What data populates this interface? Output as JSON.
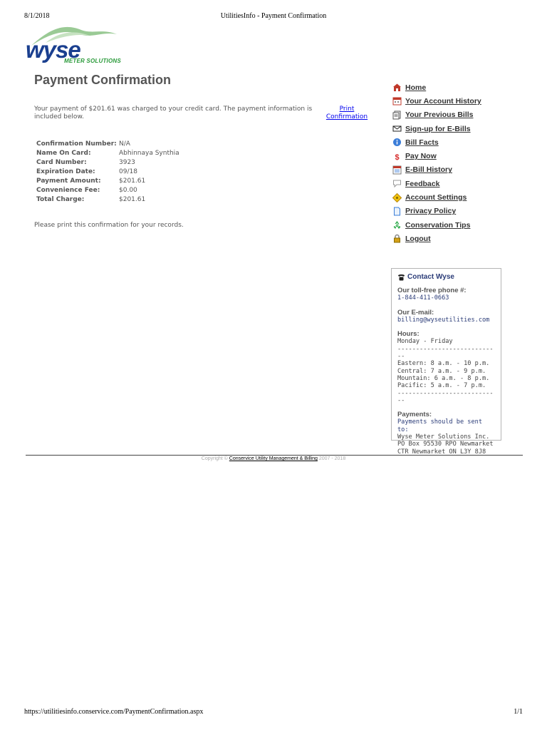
{
  "print_header": {
    "date": "8/1/2018",
    "title": "UtilitiesInfo - Payment Confirmation"
  },
  "print_footer": {
    "url": "https://utilitiesinfo.conservice.com/PaymentConfirmation.aspx",
    "page": "1/1"
  },
  "logo": {
    "word": "wyse",
    "sub": "METER SOLUTIONS",
    "colors": {
      "word": "#1a3f8f",
      "sub": "#2a9a3a",
      "swoosh": "#8fc48a"
    }
  },
  "page_title": "Payment Confirmation",
  "intro": "Your payment of $201.61 was charged to your credit card. The payment information is included below.",
  "print_link": "Print Confirmation",
  "confirmation": [
    {
      "label": "Confirmation Number:",
      "value": "N/A"
    },
    {
      "label": "Name On Card:",
      "value": "Abhinnaya Synthia"
    },
    {
      "label": "Card Number:",
      "value": "3923"
    },
    {
      "label": "Expiration Date:",
      "value": "09/18"
    },
    {
      "label": "Payment Amount:",
      "value": "$201.61"
    },
    {
      "label": "Convenience Fee:",
      "value": "$0.00"
    },
    {
      "label": "Total Charge:",
      "value": "$201.61"
    }
  ],
  "note": "Please print this confirmation for your records.",
  "nav": [
    {
      "label": "Home",
      "icon": "home-icon"
    },
    {
      "label": "Your Account History",
      "icon": "calendar-icon"
    },
    {
      "label": "Your Previous Bills",
      "icon": "bills-icon"
    },
    {
      "label": "Sign-up for E-Bills",
      "icon": "envelope-icon"
    },
    {
      "label": "Bill Facts",
      "icon": "info-icon"
    },
    {
      "label": "Pay Now",
      "icon": "dollar-icon"
    },
    {
      "label": "E-Bill History",
      "icon": "ebill-history-icon"
    },
    {
      "label": "Feedback",
      "icon": "speech-bubble-icon"
    },
    {
      "label": "Account Settings",
      "icon": "settings-diamond-icon"
    },
    {
      "label": "Privacy Policy",
      "icon": "document-icon"
    },
    {
      "label": "Conservation Tips",
      "icon": "recycle-icon"
    },
    {
      "label": "Logout",
      "icon": "lock-icon"
    }
  ],
  "contact": {
    "title": "Contact Wyse",
    "phone_label": "Our toll-free phone #:",
    "phone": "1-844-411-0663",
    "email_label": "Our E-mail:",
    "email": "billing@wyseutilities.com",
    "hours_label": "Hours:",
    "days": "Monday - Friday",
    "divider": "----------------------------",
    "hours": [
      "Eastern: 8 a.m. - 10 p.m.",
      "Central: 7 a.m. - 9 p.m.",
      "Mountain: 6 a.m. - 8 p.m.",
      "Pacific: 5 a.m. - 7 p.m."
    ],
    "payments_label": "Payments:",
    "payments_note": "Payments should be sent to:",
    "payments_address": "Wyse Meter Solutions Inc. PO Box 95530 RPO Newmarket CTR Newmarket ON L3Y 8J8"
  },
  "copyright": {
    "prefix": "Copyright ©",
    "link": "Conservice Utility Management & Billing",
    "suffix": " 2007 - 2018"
  }
}
